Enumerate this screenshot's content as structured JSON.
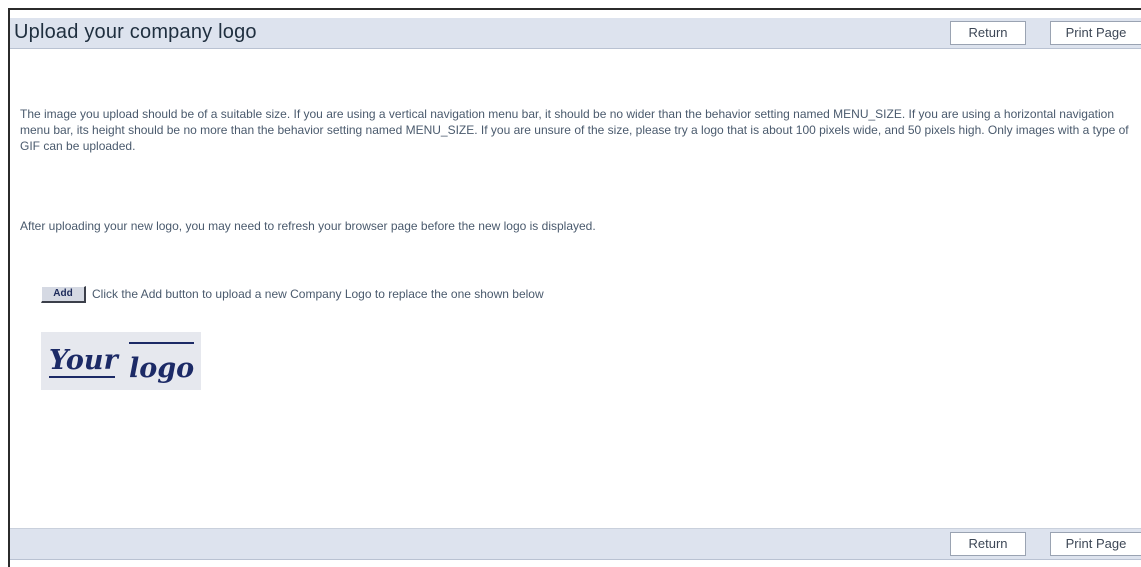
{
  "header": {
    "title": "Upload your company logo",
    "return_label": "Return",
    "print_label": "Print Page"
  },
  "main": {
    "paragraph1": "The image you upload should be of a suitable size. If you are using a vertical navigation menu bar, it should be no wider than the behavior setting named MENU_SIZE. If you are using a horizontal navigation menu bar, its height should be no more than the behavior setting named MENU_SIZE. If you are unsure of the size, please try a logo that is about 100 pixels wide, and 50 pixels high. Only images with a type of GIF can be uploaded.",
    "paragraph2": "After uploading your new logo, you may need to refresh your browser page before the new logo is displayed.",
    "add_label": "Add",
    "add_instruction": "Click the Add button to upload a new Company Logo to replace the one shown below",
    "logo_text": "Your logo"
  },
  "footer": {
    "return_label": "Return",
    "print_label": "Print Page"
  },
  "colors": {
    "bar_background": "#dde3ee",
    "text": "#4a5a6d",
    "logo_ink": "#1c2a66"
  }
}
